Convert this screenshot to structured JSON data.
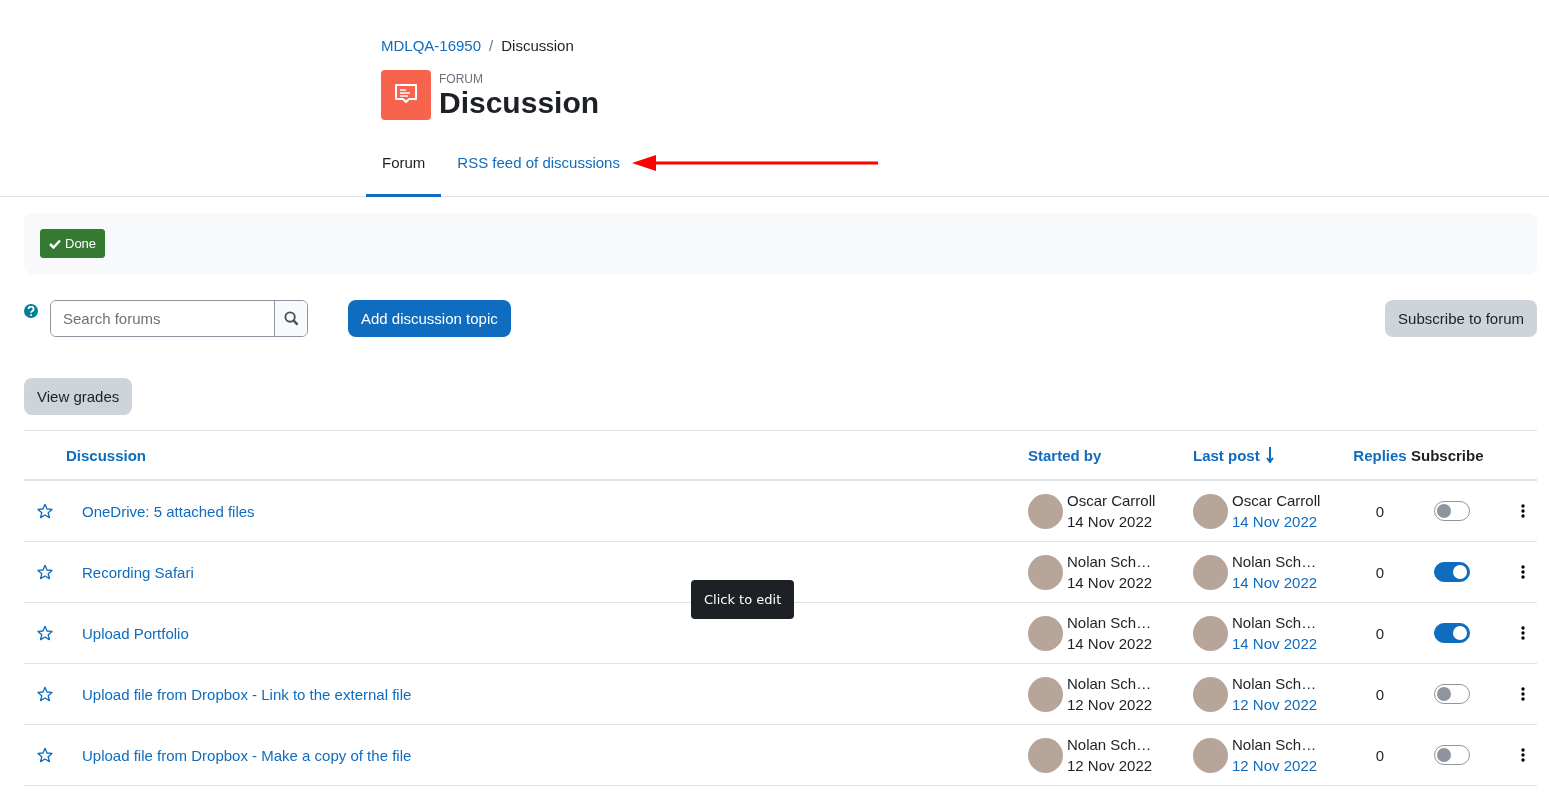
{
  "breadcrumb": [
    {
      "label": "MDLQA-16950",
      "link": true
    },
    {
      "label": "Discussion",
      "link": false
    }
  ],
  "breadcrumb_separator": "/",
  "header": {
    "overline": "FORUM",
    "title": "Discussion"
  },
  "tabs": [
    {
      "label": "Forum",
      "selected": true
    },
    {
      "label": "RSS feed of discussions",
      "selected": false
    }
  ],
  "completion": {
    "label": "Done",
    "checked": true
  },
  "search": {
    "placeholder": "Search forums"
  },
  "buttons": {
    "add": "Add discussion topic",
    "subscribe": "Subscribe to forum",
    "grades": "View grades"
  },
  "table": {
    "columns": [
      {
        "label": "Discussion",
        "sortable": true
      },
      {
        "label": "Started by",
        "sortable": true
      },
      {
        "label": "Last post",
        "sortable": true,
        "sorted": true
      },
      {
        "label": "Replies",
        "sortable": true
      },
      {
        "label": "Subscribe",
        "sortable": false
      }
    ],
    "rows": [
      {
        "starred": false,
        "title": "OneDrive: 5 attached files",
        "started_by": "Oscar Carroll",
        "started_date": "14 Nov 2022",
        "last_by": "Oscar Carroll",
        "last_date": "14 Nov 2022",
        "replies": "0",
        "subscribed": false
      },
      {
        "starred": false,
        "title": "Recording Safari",
        "started_by": "Nolan Sch…",
        "started_date": "14 Nov 2022",
        "last_by": "Nolan Sch…",
        "last_date": "14 Nov 2022",
        "replies": "0",
        "subscribed": true
      },
      {
        "starred": false,
        "title": "Upload Portfolio",
        "started_by": "Nolan Sch…",
        "started_date": "14 Nov 2022",
        "last_by": "Nolan Sch…",
        "last_date": "14 Nov 2022",
        "replies": "0",
        "subscribed": true
      },
      {
        "starred": false,
        "title": "Upload file from Dropbox - Link to the external file",
        "started_by": "Nolan Sch…",
        "started_date": "12 Nov 2022",
        "last_by": "Nolan Sch…",
        "last_date": "12 Nov 2022",
        "replies": "0",
        "subscribed": false
      },
      {
        "starred": false,
        "title": "Upload file from Dropbox - Make a copy of the file",
        "started_by": "Nolan Sch…",
        "started_date": "12 Nov 2022",
        "last_by": "Nolan Sch…",
        "last_date": "12 Nov 2022",
        "replies": "0",
        "subscribed": false
      }
    ]
  },
  "tooltip": {
    "text": "Click to edit"
  }
}
